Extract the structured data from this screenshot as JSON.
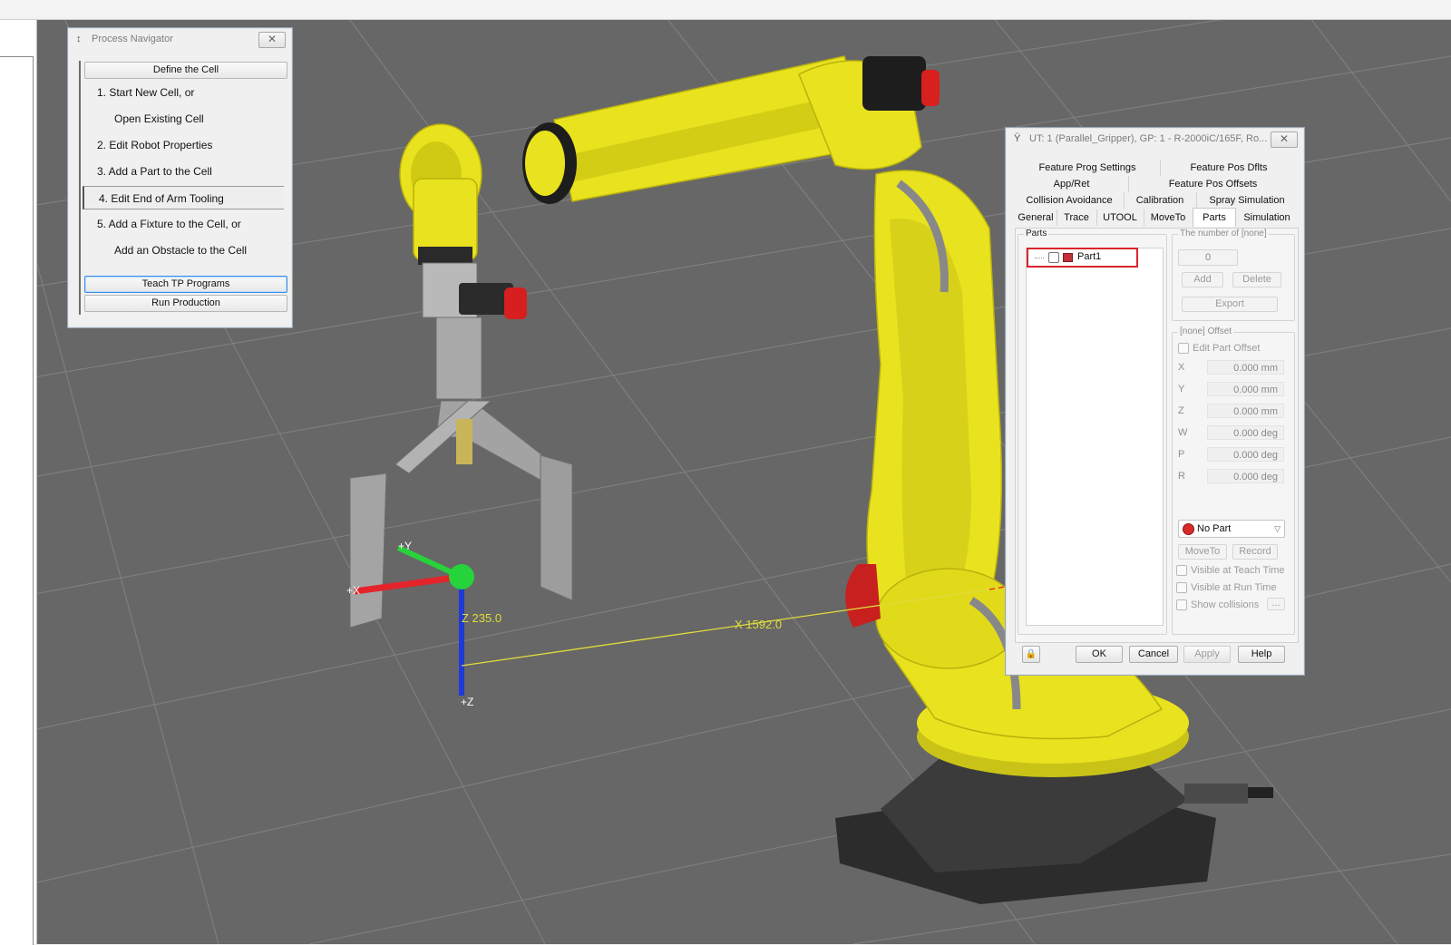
{
  "process_navigator": {
    "title": "Process Navigator",
    "close_glyph": "✕",
    "define_label": "Define the Cell",
    "steps": [
      "1.  Start New Cell, or",
      "Open Existing Cell",
      "2.  Edit Robot Properties",
      "3.  Add a Part to the Cell",
      "4.  Edit End of Arm Tooling",
      "5.  Add a Fixture to the Cell, or",
      "Add an Obstacle to the Cell"
    ],
    "teach_label": "Teach TP Programs",
    "run_label": "Run Production"
  },
  "utool_dialog": {
    "title": "UT: 1  (Parallel_Gripper), GP: 1 - R-2000iC/165F, Ro...",
    "close_glyph": "✕",
    "tab_rows": [
      [
        "Feature Prog Settings",
        "Feature Pos Dflts"
      ],
      [
        "App/Ret",
        "Feature Pos Offsets"
      ],
      [
        "Collision Avoidance",
        "Calibration",
        "Spray Simulation"
      ],
      [
        "General",
        "Trace",
        "UTOOL",
        "MoveTo",
        "Parts",
        "Simulation"
      ]
    ],
    "active_tab": "Parts",
    "parts_group_label": "Parts",
    "part_item": "Part1",
    "count_group_label": "The number of [none]",
    "count_value": "0",
    "add_label": "Add",
    "delete_label": "Delete",
    "export_label": "Export",
    "offset_group_label": "[none] Offset",
    "edit_offset_label": "Edit Part Offset",
    "offsets": [
      {
        "axis": "X",
        "value": "0.000 mm"
      },
      {
        "axis": "Y",
        "value": "0.000 mm"
      },
      {
        "axis": "Z",
        "value": "0.000 mm"
      },
      {
        "axis": "W",
        "value": "0.000 deg"
      },
      {
        "axis": "P",
        "value": "0.000 deg"
      },
      {
        "axis": "R",
        "value": "0.000 deg"
      }
    ],
    "no_part_label": "No Part",
    "moveto_label": "MoveTo",
    "record_label": "Record",
    "visible_teach_label": "Visible at Teach Time",
    "visible_run_label": "Visible at Run Time",
    "show_collisions_label": "Show collisions",
    "ellipsis_label": "...",
    "ok_label": "OK",
    "cancel_label": "Cancel",
    "apply_label": "Apply",
    "help_label": "Help"
  },
  "viewport": {
    "axis_y_label": "+Y",
    "axis_x_label": "+X",
    "axis_z_label": "+Z",
    "z_readout": "Z 235.0",
    "x_readout": "X 1592.0"
  },
  "colors": {
    "robot_yellow": "#e9e21e",
    "floor_gray": "#676767",
    "axis_x": "#e3242b",
    "axis_y": "#27d33a",
    "axis_z": "#1f3ad6",
    "measure_line": "#e0dc3a"
  }
}
